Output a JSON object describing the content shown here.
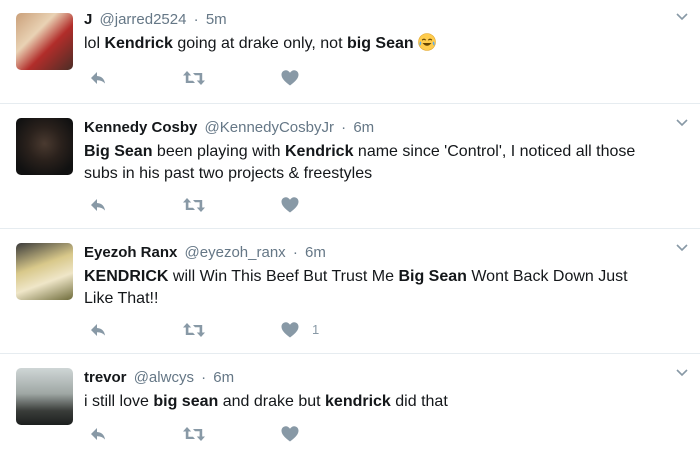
{
  "tweets": [
    {
      "name": "J",
      "handle": "@jarred2524",
      "separator": "·",
      "time": "5m",
      "segments": [
        {
          "text": "lol ",
          "bold": false
        },
        {
          "text": "Kendrick",
          "bold": true
        },
        {
          "text": " going at drake only, not ",
          "bold": false
        },
        {
          "text": "big Sean",
          "bold": true
        }
      ],
      "emoji": "face-with-tears-of-joy-icon",
      "like_count": ""
    },
    {
      "name": "Kennedy Cosby",
      "handle": "@KennedyCosbyJr",
      "separator": "·",
      "time": "6m",
      "segments": [
        {
          "text": "Big Sean",
          "bold": true
        },
        {
          "text": " been playing with ",
          "bold": false
        },
        {
          "text": "Kendrick",
          "bold": true
        },
        {
          "text": " name since 'Control', I noticed all those subs in his past two projects & freestyles",
          "bold": false
        }
      ],
      "like_count": ""
    },
    {
      "name": "Eyezoh Ranx",
      "handle": "@eyezoh_ranx",
      "separator": "·",
      "time": "6m",
      "segments": [
        {
          "text": "KENDRICK",
          "bold": true
        },
        {
          "text": " will Win This Beef But Trust Me ",
          "bold": false
        },
        {
          "text": "Big Sean",
          "bold": true
        },
        {
          "text": " Wont Back Down Just Like That!!",
          "bold": false
        }
      ],
      "like_count": "1"
    },
    {
      "name": "trevor",
      "handle": "@alwcys",
      "separator": "·",
      "time": "6m",
      "segments": [
        {
          "text": "i still love ",
          "bold": false
        },
        {
          "text": "big sean",
          "bold": true
        },
        {
          "text": " and drake but ",
          "bold": false
        },
        {
          "text": "kendrick",
          "bold": true
        },
        {
          "text": " did that",
          "bold": false
        }
      ],
      "like_count": ""
    }
  ],
  "colors": {
    "icon": "#8899a6",
    "secondary_text": "#657786",
    "divider": "#e6ecf0"
  }
}
